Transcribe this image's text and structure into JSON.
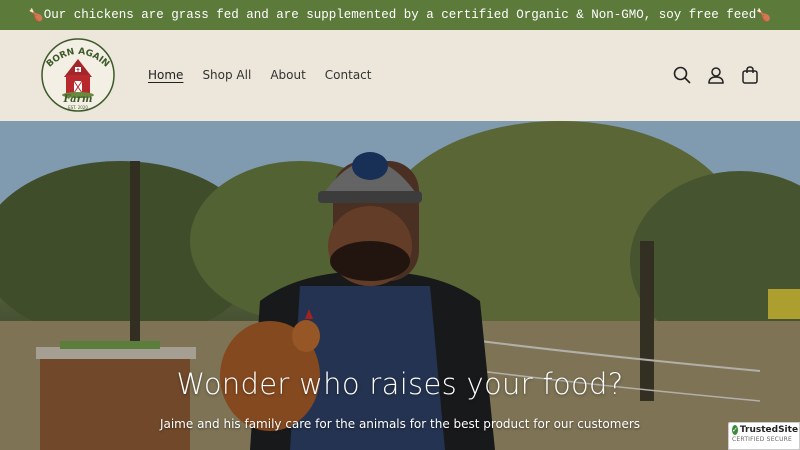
{
  "announcement": {
    "emoji_left": "🍗",
    "text": "Our chickens are grass fed and are supplemented by a certified Organic & Non-GMO, soy free feed",
    "emoji_right": "🍗"
  },
  "logo": {
    "line1": "BORN AGAIN",
    "line2": "Farm",
    "line3": "EST. 2020"
  },
  "nav": {
    "items": [
      {
        "label": "Home",
        "active": true
      },
      {
        "label": "Shop All",
        "active": false
      },
      {
        "label": "About",
        "active": false
      },
      {
        "label": "Contact",
        "active": false
      }
    ]
  },
  "header_icons": [
    "search-icon",
    "account-icon",
    "cart-icon"
  ],
  "hero": {
    "title": "Wonder who raises your food?",
    "subtitle": "Jaime and his family care for the animals for the best product for our customers"
  },
  "trusted_badge": {
    "name": "TrustedSite",
    "tagline": "CERTIFIED SECURE"
  },
  "colors": {
    "announcement_bg": "#5c7a3a",
    "header_bg": "#ece6db",
    "text": "#333333"
  }
}
